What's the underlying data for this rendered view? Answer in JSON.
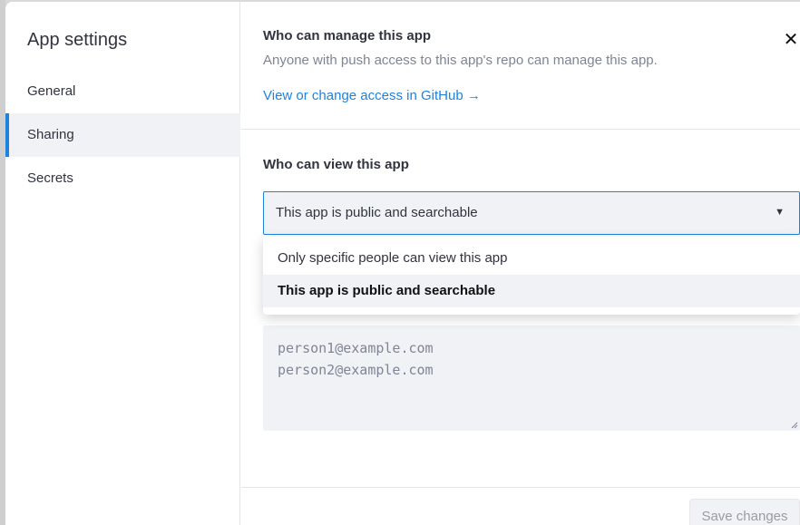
{
  "sidebar": {
    "title": "App settings",
    "items": [
      {
        "label": "General",
        "active": false
      },
      {
        "label": "Sharing",
        "active": true
      },
      {
        "label": "Secrets",
        "active": false
      }
    ]
  },
  "manage": {
    "heading": "Who can manage this app",
    "description": "Anyone with push access to this app's repo can manage this app.",
    "github_link": "View or change access in GitHub →"
  },
  "view": {
    "heading": "Who can view this app",
    "selected": "This app is public and searchable",
    "options": [
      "Only specific people can view this app",
      "This app is public and searchable"
    ]
  },
  "emails": {
    "placeholder_lines": [
      "person1@example.com",
      "person2@example.com"
    ]
  },
  "footer": {
    "save_label": "Save changes"
  },
  "icons": {
    "close": "close-icon",
    "caret": "caret-down-icon"
  },
  "colors": {
    "accent": "#1c83e1",
    "muted": "#808495",
    "surface": "#f0f2f6"
  }
}
